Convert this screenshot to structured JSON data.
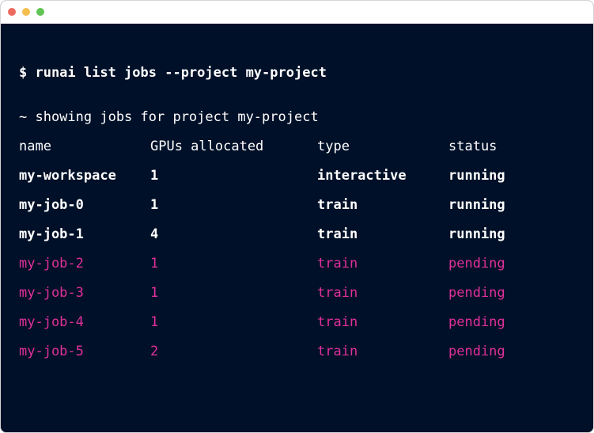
{
  "window": {
    "controls": {
      "close_color": "#ed6a5e",
      "minimize_color": "#f5bf4f",
      "maximize_color": "#61c554"
    }
  },
  "terminal": {
    "command": "$ runai list jobs --project my-project",
    "comment": "~ showing jobs for project my-project",
    "columns": [
      "name",
      "GPUs allocated",
      "type",
      "status"
    ],
    "rows": [
      {
        "name": "my-workspace",
        "gpus": "1",
        "type": "interactive",
        "status": "running",
        "state": "active"
      },
      {
        "name": "my-job-0",
        "gpus": "1",
        "type": "train",
        "status": "running",
        "state": "active"
      },
      {
        "name": "my-job-1",
        "gpus": "4",
        "type": "train",
        "status": "running",
        "state": "active"
      },
      {
        "name": "my-job-2",
        "gpus": "1",
        "type": "train",
        "status": "pending",
        "state": "pending"
      },
      {
        "name": "my-job-3",
        "gpus": "1",
        "type": "train",
        "status": "pending",
        "state": "pending"
      },
      {
        "name": "my-job-4",
        "gpus": "1",
        "type": "train",
        "status": "pending",
        "state": "pending"
      },
      {
        "name": "my-job-5",
        "gpus": "2",
        "type": "train",
        "status": "pending",
        "state": "pending"
      }
    ],
    "colors": {
      "background": "#001028",
      "text": "#ffffff",
      "pending": "#e0309a"
    }
  }
}
